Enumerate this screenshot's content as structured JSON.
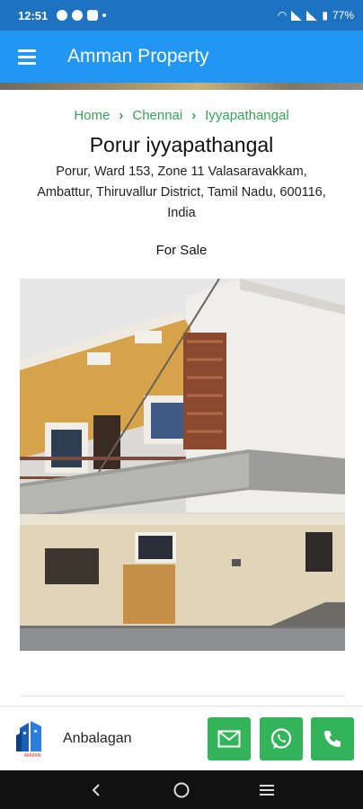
{
  "status_bar": {
    "time": "12:51",
    "battery": "77%"
  },
  "app_bar": {
    "title": "Amman Property",
    "menu_icon": "hamburger-menu-icon"
  },
  "breadcrumb": {
    "items": [
      "Home",
      "Chennai",
      "Iyyapathangal"
    ],
    "separator": "›"
  },
  "property": {
    "title": "Porur iyyapathangal",
    "address": "Porur, Ward 153, Zone 11 Valasaravakkam, Ambattur, Thiruvallur District, Tamil Nadu, 600116, India",
    "listing_status": "For Sale"
  },
  "contact": {
    "agent_name": "Anbalagan",
    "logo_text": "AMMAN",
    "buttons": [
      "mail-icon",
      "whatsapp-icon",
      "phone-icon"
    ]
  },
  "colors": {
    "status_bar": "#1d73c2",
    "app_bar": "#2196f3",
    "accent_green": "#31a853",
    "button_green": "#33b35a"
  }
}
